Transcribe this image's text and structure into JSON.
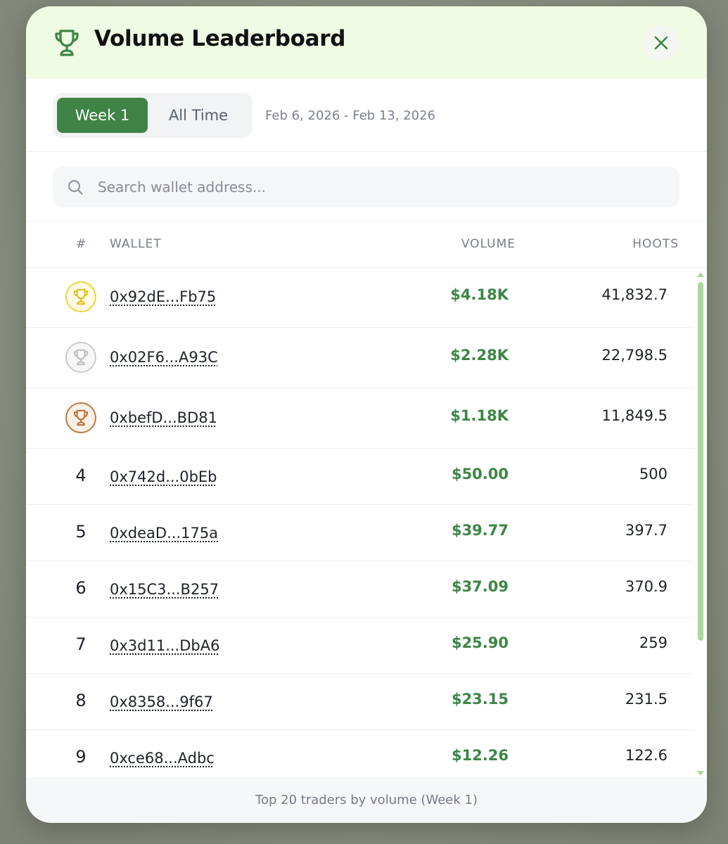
{
  "header": {
    "title": "Volume Leaderboard",
    "trophy_icon": "trophy-icon",
    "close_icon": "close-icon"
  },
  "tabs": {
    "items": [
      "Week 1",
      "All Time"
    ],
    "active": "Week 1",
    "date_range": "Feb 6, 2026 - Feb 13, 2026"
  },
  "search": {
    "placeholder": "Search wallet address...",
    "value": ""
  },
  "table": {
    "columns": [
      "#",
      "WALLET",
      "VOLUME",
      "HOOTS"
    ],
    "rows": [
      {
        "rank": "1",
        "medal": "gold",
        "wallet": "0x92dE...Fb75",
        "volume": "$4.18K",
        "hoots": "41,832.7"
      },
      {
        "rank": "2",
        "medal": "silver",
        "wallet": "0x02F6...A93C",
        "volume": "$2.28K",
        "hoots": "22,798.5"
      },
      {
        "rank": "3",
        "medal": "bronze",
        "wallet": "0xbefD...BD81",
        "volume": "$1.18K",
        "hoots": "11,849.5"
      },
      {
        "rank": "4",
        "wallet": "0x742d...0bEb",
        "volume": "$50.00",
        "hoots": "500"
      },
      {
        "rank": "5",
        "wallet": "0xdeaD...175a",
        "volume": "$39.77",
        "hoots": "397.7"
      },
      {
        "rank": "6",
        "wallet": "0x15C3...B257",
        "volume": "$37.09",
        "hoots": "370.9"
      },
      {
        "rank": "7",
        "wallet": "0x3d11...DbA6",
        "volume": "$25.90",
        "hoots": "259"
      },
      {
        "rank": "8",
        "wallet": "0x8358...9f67",
        "volume": "$23.15",
        "hoots": "231.5"
      },
      {
        "rank": "9",
        "wallet": "0xce68...Adbc",
        "volume": "$12.26",
        "hoots": "122.6"
      }
    ]
  },
  "footer": {
    "text": "Top 20 traders by volume (Week 1)"
  },
  "colors": {
    "accent_green": "#3f8446",
    "header_bg": "#f0fbe3",
    "gold": "#f2d43c",
    "silver": "#c9c9c9",
    "bronze": "#c07a3c"
  }
}
